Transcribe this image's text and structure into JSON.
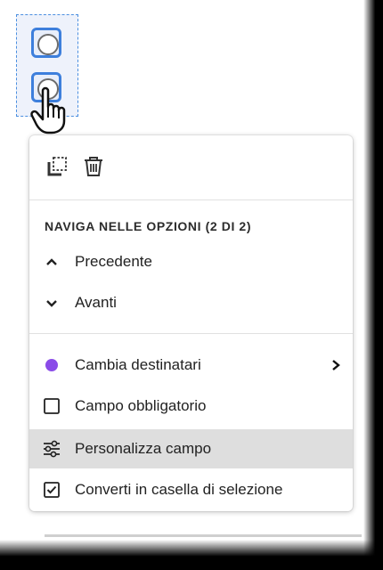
{
  "menu": {
    "section_title": "NAVIGA NELLE OPZIONI (2 DI 2)",
    "nav_items": [
      {
        "label": "Precedente",
        "icon": "chevron-up-icon"
      },
      {
        "label": "Avanti",
        "icon": "chevron-down-icon"
      }
    ],
    "actions": [
      {
        "label": "Cambia destinatari",
        "icon": "purple-dot-icon",
        "has_submenu": true
      },
      {
        "label": "Campo obbligatorio",
        "icon": "checkbox-empty-icon"
      },
      {
        "label": "Personalizza campo",
        "icon": "sliders-icon",
        "highlighted": true
      },
      {
        "label": "Converti in casella di selezione",
        "icon": "checkbox-checked-icon"
      }
    ]
  },
  "colors": {
    "accent_blue": "#3d7fdc",
    "recipient_dot": "#8a4be8",
    "highlight_bg": "#dedede"
  }
}
